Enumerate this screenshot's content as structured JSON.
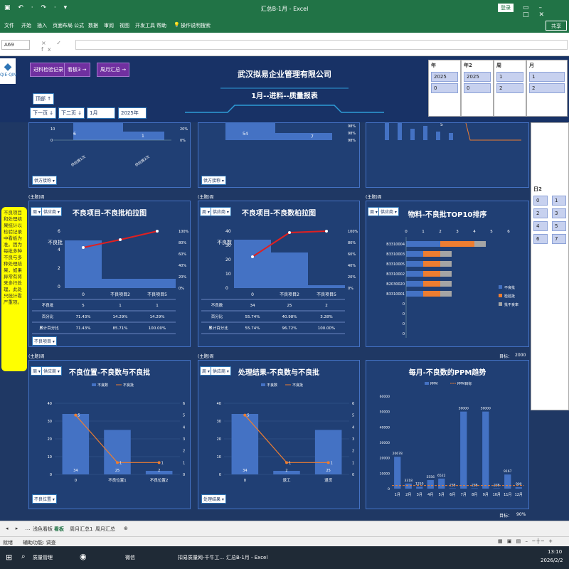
{
  "window": {
    "title": "汇总B-1月 - Excel",
    "login": "登录",
    "quick": "▣ ↶ · ↷ · ▾"
  },
  "ribbon": {
    "tabs": [
      "文件",
      "开始",
      "插入",
      "页面布局",
      "公式",
      "数据",
      "审阅",
      "视图",
      "开发工具",
      "帮助"
    ],
    "search": "操作说明搜索",
    "share": "共享"
  },
  "formula": {
    "cell_ref": "A69",
    "fx": "× ✓ fx"
  },
  "header": {
    "company": "武汉拟易企业管理有限公司",
    "report": "1月--进料--质量报表",
    "logo": "QIE·QIN",
    "buttons": [
      "进料检验记录",
      "看板3 →",
      "周月汇总 →"
    ],
    "nav_top": "顶部 ↑",
    "nav_prev": "下一页 ↓",
    "nav_next": "下二页 ↓",
    "month_sel": "1月",
    "year_sel": "2025年"
  },
  "slicers": [
    {
      "h": "年",
      "items": [
        "2025",
        "0"
      ]
    },
    {
      "h": "年2",
      "items": [
        "2025",
        "0"
      ]
    },
    {
      "h": "周",
      "items": [
        "1",
        "2"
      ]
    },
    {
      "h": "月",
      "items": [
        "1",
        "2"
      ]
    }
  ],
  "slicer_day": {
    "h": "日2",
    "items": [
      "0",
      "1",
      "2",
      "3",
      "4",
      "5",
      "6",
      "7"
    ]
  },
  "top_row": {
    "p1_values": [
      "6",
      "1"
    ],
    "p1_cats": [
      "供应商1次",
      "供应商2次"
    ],
    "p1_pct": [
      "20%",
      "0%"
    ],
    "p2_values": [
      "54",
      "7"
    ],
    "p2_pct": [
      "98%",
      "98%",
      "98%"
    ],
    "p1_filter": "供方接称 ▾",
    "p2_filter": "供方接称 ▾",
    "p3_val": "5",
    "left_axis": [
      "10",
      "0"
    ]
  },
  "cl": "(主题)周",
  "panel_a": {
    "title": "不良项目-不良批柏拉图",
    "sel1": "周 ▾",
    "sel2": "供应商 ▾",
    "ylabel": "不良批",
    "yticks": [
      "6",
      "4",
      "2",
      "0"
    ],
    "y2": [
      "100%",
      "80%",
      "60%",
      "40%",
      "20%",
      "0%"
    ],
    "cats": [
      "0",
      "不良项目2",
      "不良项目5"
    ],
    "rows": [
      [
        "不良批",
        "5",
        "1",
        "1"
      ],
      [
        "百分比",
        "71.43%",
        "14.29%",
        "14.29%"
      ],
      [
        "累计百分比",
        "71.43%",
        "85.71%",
        "100.00%"
      ]
    ],
    "filter": "不良项目 ▾"
  },
  "panel_b": {
    "title": "不良项目-不良数柏拉图",
    "sel1": "周 ▾",
    "sel2": "供应商 ▾",
    "ylabel": "不良数",
    "yticks": [
      "40",
      "30",
      "20",
      "10",
      "0"
    ],
    "y2": [
      "100%",
      "80%",
      "60%",
      "40%",
      "20%",
      "0%"
    ],
    "cats": [
      "0",
      "不良项目2",
      "不良项目5"
    ],
    "rows": [
      [
        "不良数",
        "34",
        "25",
        "2"
      ],
      [
        "百分比",
        "55.74%",
        "40.98%",
        "3.28%"
      ],
      [
        "累计百分比",
        "55.74%",
        "96.72%",
        "100.00%"
      ]
    ]
  },
  "panel_c": {
    "title": "物料-不良批TOP10排序",
    "sel1": "周 ▾",
    "sel2": "供应商 ▾",
    "xticks": [
      "0",
      "1",
      "2",
      "3",
      "4",
      "5",
      "6"
    ],
    "items": [
      "B3310004",
      "B3310003",
      "B3310005",
      "B3310002",
      "B2030020",
      "B3310001",
      "0",
      "0",
      "0",
      "0"
    ],
    "legend": [
      "不良批",
      "检验批",
      "批不良率"
    ],
    "target_label": "目标：",
    "target": "2000"
  },
  "panel_d": {
    "title": "不良位置-不良数与不良批",
    "sel1": "周 ▾",
    "sel2": "供应商 ▾",
    "legend": [
      "不良数",
      "不良批"
    ],
    "yticks": [
      "40",
      "30",
      "20",
      "10",
      "0"
    ],
    "y2": [
      "6",
      "5",
      "4",
      "3",
      "2",
      "1",
      "0"
    ],
    "cats": [
      "0",
      "不良位置1",
      "不良位置2"
    ],
    "bars": [
      34,
      25,
      2
    ],
    "line": [
      5,
      1,
      1
    ],
    "filter": "不良位置 ▾"
  },
  "panel_e": {
    "title": "处理结果-不良数与不良批",
    "sel1": "周 ▾",
    "sel2": "供应商 ▾",
    "legend": [
      "不良数",
      "不良批"
    ],
    "yticks": [
      "40",
      "30",
      "20",
      "10",
      "0"
    ],
    "y2": [
      "6",
      "5",
      "4",
      "3",
      "2",
      "1",
      "0"
    ],
    "cats": [
      "0",
      "退工",
      "退货"
    ],
    "bars": [
      34,
      2,
      25
    ],
    "line": [
      5,
      1,
      1
    ],
    "filter": "处理结果 ▾"
  },
  "panel_f": {
    "title": "每月-不良数的PPM趋势",
    "legend": [
      "PPM",
      "PPM目标"
    ],
    "yticks": [
      "60000",
      "50000",
      "40000",
      "30000",
      "20000",
      "10000",
      "0"
    ],
    "months": [
      "1月",
      "2月",
      "3月",
      "4月",
      "5月",
      "6月",
      "7月",
      "8月",
      "9月",
      "10月",
      "11月",
      "12月"
    ],
    "values": [
      20678,
      3318,
      1250,
      5556,
      6522,
      238,
      50000,
      238,
      50000,
      238,
      9167,
      909
    ],
    "target_label": "目标：",
    "target": "90%"
  },
  "note": "不良项目和处理结果统计以检验记录中看板为准。因为每批多种不良与多种处理结果，如果异常有将来多行处理，此处只统计看严重项。",
  "tabs": [
    "浅色看板",
    "看板",
    "周月汇总1",
    "周月汇总"
  ],
  "status": {
    "left": "就绪",
    "access": "辅助功能: 调查"
  },
  "taskbar": {
    "apps": [
      "质量管理",
      "微信",
      "扣易质量网-千牛工...",
      "汇总B-1月 - Excel"
    ],
    "time": "13:10",
    "date": "2026/2/2"
  }
}
